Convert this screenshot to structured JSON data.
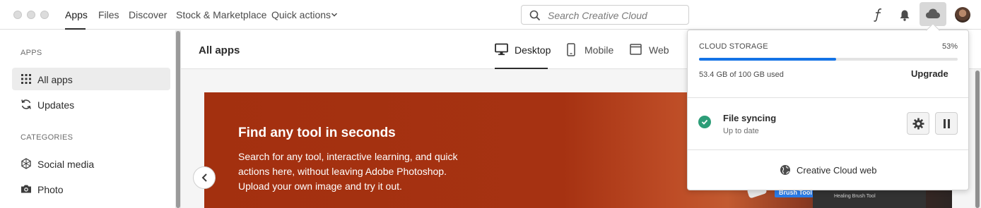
{
  "topbar": {
    "nav": [
      "Apps",
      "Files",
      "Discover",
      "Stock & Marketplace",
      "Quick actions"
    ],
    "active_nav": "Apps",
    "search_placeholder": "Search Creative Cloud",
    "icons": [
      "search-icon",
      "fonts-icon",
      "bell-icon",
      "cloud-icon",
      "avatar"
    ]
  },
  "sidebar": {
    "apps_heading": "APPS",
    "items": [
      {
        "label": "All apps",
        "icon": "grid-icon",
        "selected": true
      },
      {
        "label": "Updates",
        "icon": "refresh-icon",
        "selected": false
      }
    ],
    "categories_heading": "CATEGORIES",
    "categories": [
      {
        "label": "Social media",
        "icon": "social-icon"
      },
      {
        "label": "Photo",
        "icon": "camera-icon"
      }
    ]
  },
  "main": {
    "title": "All apps",
    "tabs": [
      {
        "label": "Desktop",
        "icon": "desktop-icon",
        "active": true
      },
      {
        "label": "Mobile",
        "icon": "mobile-icon",
        "active": false
      },
      {
        "label": "Web",
        "icon": "web-icon",
        "active": false
      }
    ],
    "banner": {
      "title": "Find any tool in seconds",
      "body": "Search for any tool, interactive learning, and quick actions here, without leaving Adobe Photoshop. Upload your own image and try it out.",
      "tool_tag": "Brush Tool",
      "panel_text": "Healing Brush Tool"
    }
  },
  "cloud_popover": {
    "title": "CLOUD STORAGE",
    "percent_label": "53%",
    "percent": 53,
    "used_text": "53.4 GB of 100 GB used",
    "upgrade_label": "Upgrade",
    "sync_title": "File syncing",
    "sync_status": "Up to date",
    "web_link": "Creative Cloud web"
  },
  "colors": {
    "accent": "#1473e6",
    "success": "#2d9d78",
    "banner": "#a3300f"
  }
}
